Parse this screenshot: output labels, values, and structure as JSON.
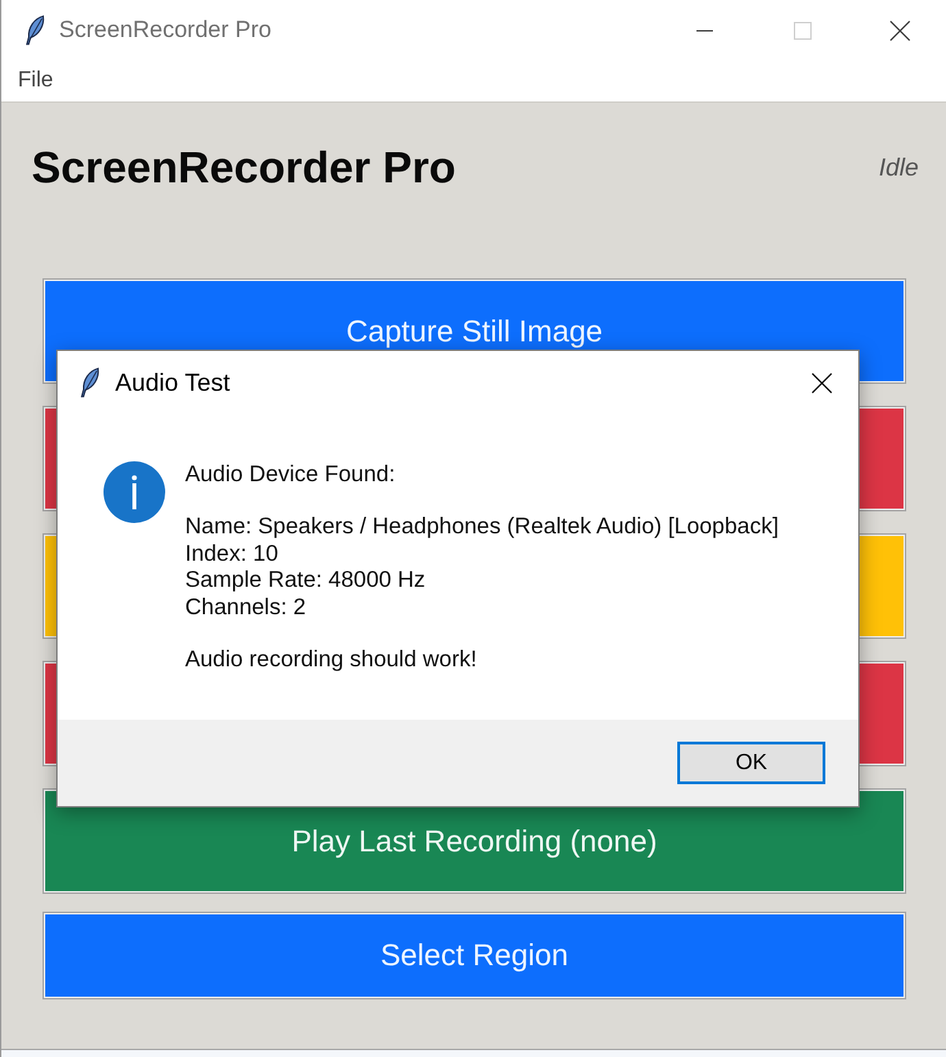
{
  "window": {
    "title": "ScreenRecorder Pro",
    "controls": [
      {
        "kind": "minimize",
        "disabled": false
      },
      {
        "kind": "maximize",
        "disabled": true
      },
      {
        "kind": "close",
        "disabled": false
      }
    ]
  },
  "menu": [
    {
      "label": "File"
    }
  ],
  "header": {
    "title": "ScreenRecorder Pro",
    "status": "Idle"
  },
  "buttons": [
    {
      "label": "Capture Still Image",
      "color": "#0d6efd"
    },
    {
      "color": "#dc3545"
    },
    {
      "color": "#ffc107"
    },
    {
      "color": "#dc3545"
    },
    {
      "label": "Play Last Recording (none)",
      "color": "#198754"
    },
    {
      "label": "Select Region",
      "color": "#0d6efd"
    }
  ],
  "dialog": {
    "title": "Audio Test",
    "paragraphs": [
      [
        "Audio Device Found:"
      ],
      [
        "Name: Speakers / Headphones (Realtek Audio) [Loopback]",
        "Index: 10",
        "Sample Rate: 48000 Hz",
        "Channels: 2"
      ],
      [
        "Audio recording should work!"
      ]
    ],
    "buttons": [
      {
        "label": "OK",
        "default": true
      }
    ]
  }
}
